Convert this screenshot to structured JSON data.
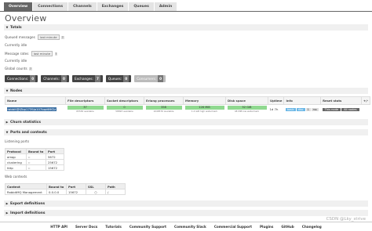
{
  "tabs": [
    "Overview",
    "Connections",
    "Channels",
    "Exchanges",
    "Queues",
    "Admin"
  ],
  "page_title": "Overview",
  "totals": {
    "heading": "Totals",
    "queued_messages_label": "Queued messages",
    "queued_messages_select": "last minute",
    "currently_idle_1": "Currently idle",
    "message_rates_label": "Message rates",
    "message_rates_select": "last minute",
    "currently_idle_2": "Currently idle",
    "global_counts_label": "Global counts",
    "help": "?"
  },
  "counts": [
    {
      "label": "Connections:",
      "value": "0"
    },
    {
      "label": "Channels:",
      "value": "0"
    },
    {
      "label": "Exchanges:",
      "value": "7"
    },
    {
      "label": "Queues:",
      "value": "0"
    },
    {
      "label": "Consumers:",
      "value": "0"
    }
  ],
  "nodes": {
    "heading": "Nodes",
    "columns": [
      "Name",
      "File descriptors",
      "Socket descriptors",
      "Erlang processes",
      "Memory",
      "Disk space",
      "Uptime",
      "Info",
      "Reset stats"
    ],
    "plus_minus": "+/-",
    "row": {
      "name": "rabbit@lZbp1739ja107bqd69f2z",
      "file_desc": "37",
      "file_desc_sub": "65536 available",
      "socket_desc": "0",
      "socket_desc_sub": "58893 available",
      "erlang": "358",
      "erlang_sub": "1048576 available",
      "memory": "126 MiB",
      "memory_sub": "1.4 GiB high watermark",
      "disk": "52 GiB",
      "disk_sub": "48 MiB low watermark",
      "uptime": "1d 7h",
      "info_tags": [
        "basic",
        "disc",
        "1",
        "rss"
      ],
      "reset_this": "This node",
      "reset_all": "All nodes"
    }
  },
  "churn_heading": "Churn statistics",
  "ports": {
    "heading": "Ports and contexts",
    "listening_label": "Listening ports",
    "columns": [
      "Protocol",
      "Bound to",
      "Port"
    ],
    "rows": [
      {
        "protocol": "amqp",
        "bound": "::",
        "port": "5672"
      },
      {
        "protocol": "clustering",
        "bound": "::",
        "port": "25672"
      },
      {
        "protocol": "http",
        "bound": "::",
        "port": "15672"
      }
    ],
    "web_label": "Web contexts",
    "web_columns": [
      "Context",
      "Bound to",
      "Port",
      "SSL",
      "Path"
    ],
    "web_rows": [
      {
        "context": "RabbitMQ Management",
        "bound": "0.0.0.0",
        "port": "15672",
        "ssl": "○",
        "path": "/"
      }
    ]
  },
  "export_heading": "Export definitions",
  "import_heading": "Import definitions",
  "footer": [
    "HTTP API",
    "Server Docs",
    "Tutorials",
    "Community Support",
    "Community Slack",
    "Commercial Support",
    "Plugins",
    "GitHub",
    "Changelog"
  ],
  "watermark": "CSDN @Lky_strive"
}
